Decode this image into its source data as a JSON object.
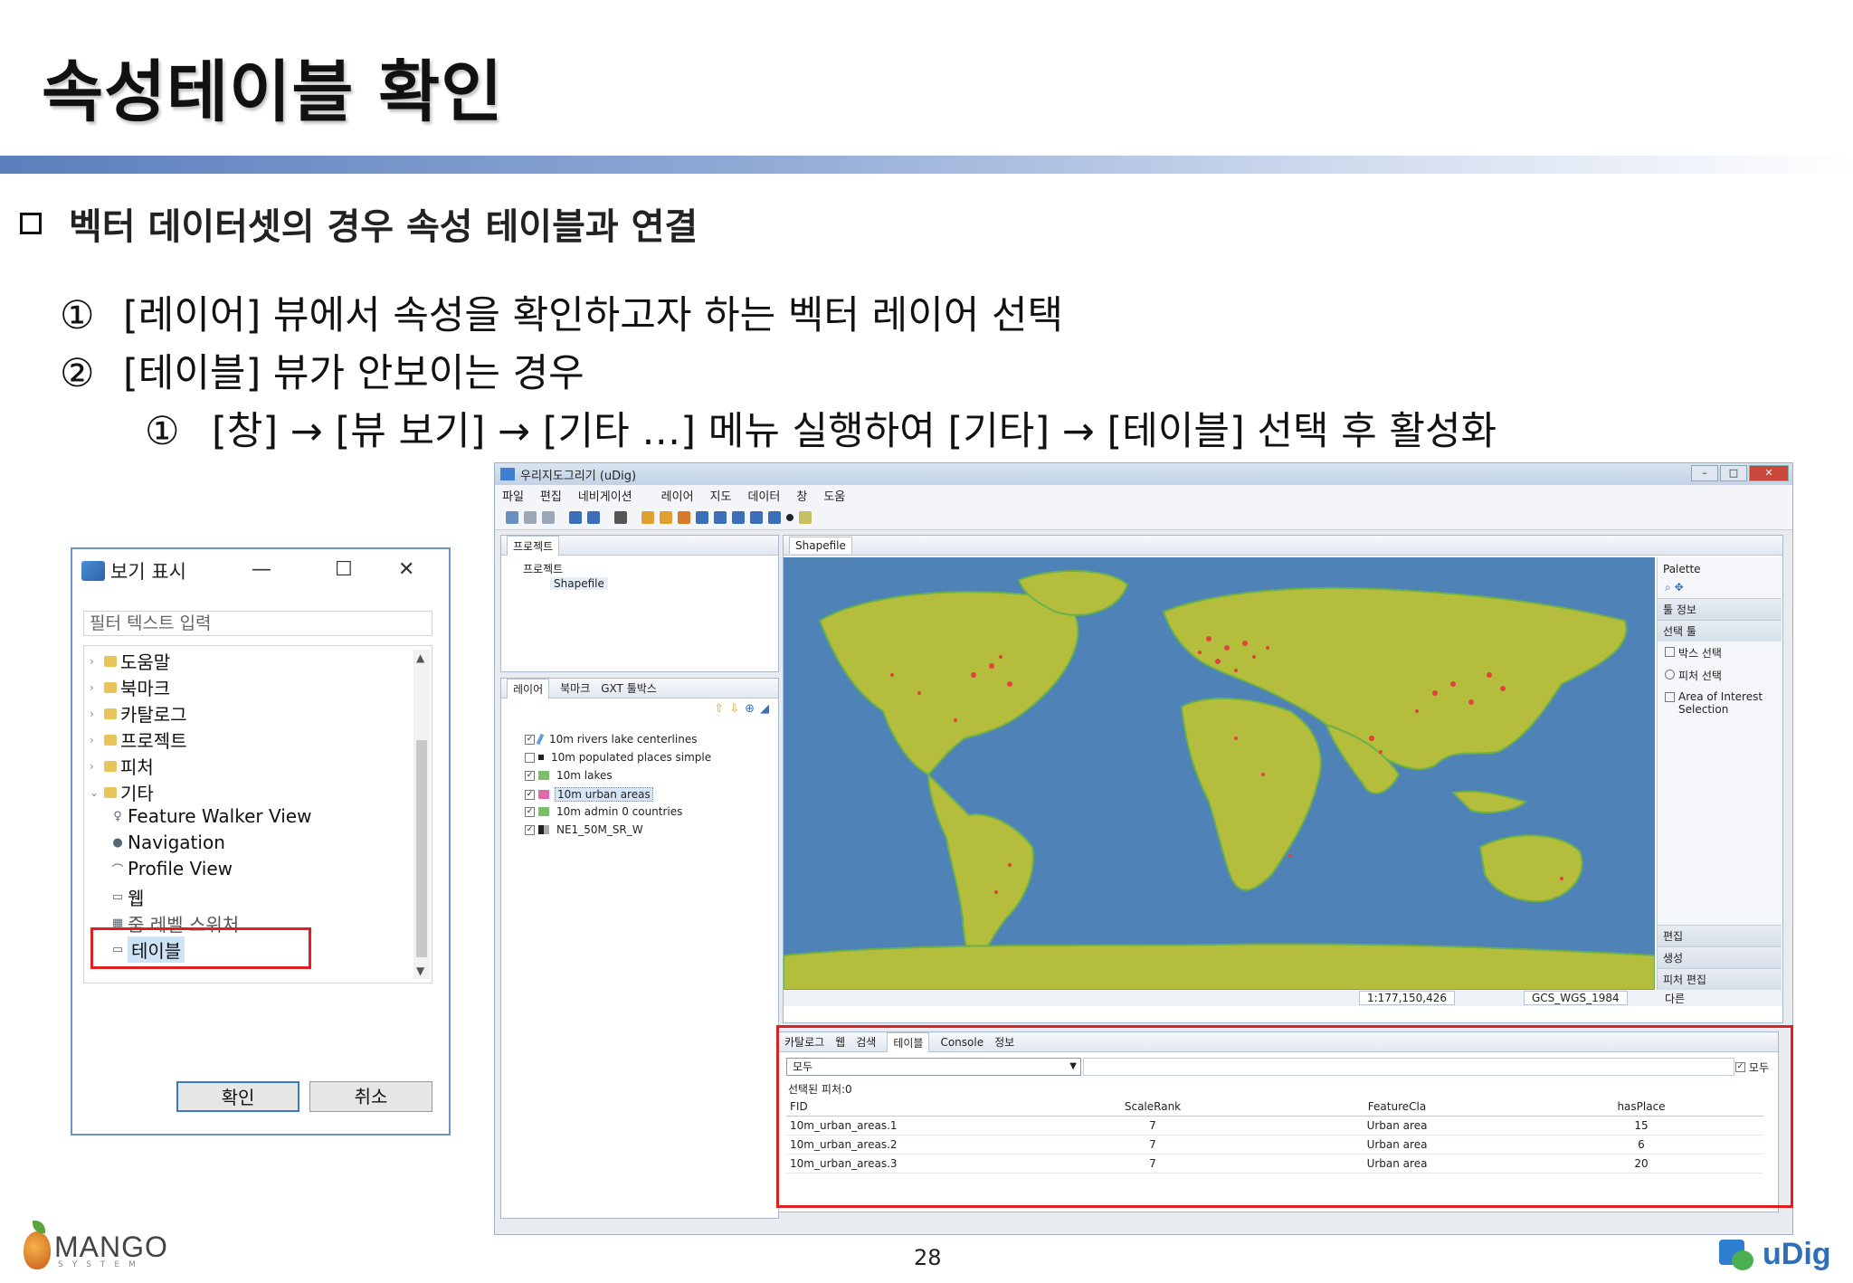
{
  "slide": {
    "title": "속성테이블 확인",
    "bullet": "벡터 데이터셋의 경우 속성 테이블과 연결",
    "steps": [
      {
        "num": "①",
        "text": "[레이어] 뷰에서 속성을 확인하고자 하는 벡터 레이어 선택"
      },
      {
        "num": "②",
        "text": "[테이블] 뷰가 안보이는 경우"
      },
      {
        "num": "①",
        "text": "[창] → [뷰 보기] → [기타 …] 메뉴 실행하여 [기타] → [테이블] 선택 후 활성화"
      }
    ],
    "page_number": "28",
    "logo_left": "MANGO",
    "logo_left_sub": "SYSTEM",
    "logo_right": "uDig"
  },
  "dialog": {
    "title": "보기 표시",
    "filter_placeholder": "필터 텍스트 입력",
    "tree": [
      {
        "label": "도움말",
        "kind": "folder"
      },
      {
        "label": "북마크",
        "kind": "folder"
      },
      {
        "label": "카탈로그",
        "kind": "folder"
      },
      {
        "label": "프로젝트",
        "kind": "folder"
      },
      {
        "label": "피처",
        "kind": "folder"
      },
      {
        "label": "기타",
        "kind": "folder-open"
      },
      {
        "label": "Feature Walker View",
        "kind": "view"
      },
      {
        "label": "Navigation",
        "kind": "view"
      },
      {
        "label": "Profile View",
        "kind": "view"
      },
      {
        "label": "웹",
        "kind": "view"
      },
      {
        "label": "줌 레벨 스위처",
        "kind": "view"
      },
      {
        "label": "테이블",
        "kind": "view-selected"
      }
    ],
    "ok": "확인",
    "cancel": "취소",
    "min": "—",
    "max": "☐",
    "close": "✕"
  },
  "udig": {
    "window_title": "우리지도그리기 (uDig)",
    "menu": [
      "파일",
      "편집",
      "네비게이션",
      "레이어",
      "지도",
      "데이터",
      "창",
      "도움"
    ],
    "project_tab": "프로젝트",
    "project_root": "프로젝트",
    "project_child": "Shapefile",
    "layer_tabs": [
      "레이어",
      "북마크",
      "GXT 툴박스"
    ],
    "layers": [
      {
        "name": "10m rivers lake centerlines",
        "checked": true,
        "color": "#6aa0d8"
      },
      {
        "name": "10m populated places simple",
        "checked": false,
        "color": "#222222"
      },
      {
        "name": "10m lakes",
        "checked": true,
        "color": "#7bbf6a"
      },
      {
        "name": "10m urban areas",
        "checked": true,
        "color": "#e06aa8",
        "selected": true
      },
      {
        "name": "10m admin 0 countries",
        "checked": true,
        "color": "#7bbf6a"
      },
      {
        "name": "NE1_50M_SR_W",
        "checked": true,
        "color": "#333333"
      }
    ],
    "map_tab": "Shapefile",
    "palette": {
      "title": "Palette",
      "sections": [
        "툴 정보",
        "선택 툴"
      ],
      "items": [
        "박스 선택",
        "피처 선택",
        "Area of Interest Selection"
      ],
      "bottom_sections": [
        "편집",
        "생성",
        "피처 편집"
      ]
    },
    "status": {
      "scale": "1:177,150,426",
      "crs": "GCS_WGS_1984",
      "extra": "다른"
    },
    "bottom_tabs": [
      "카탈로그",
      "웹",
      "검색",
      "테이블",
      "Console",
      "정보"
    ],
    "table": {
      "combo": "모두",
      "all_label": "모두",
      "selected_count": "선택된 피처:0",
      "columns": [
        "FID",
        "ScaleRank",
        "FeatureCla",
        "hasPlace"
      ],
      "rows": [
        [
          "10m_urban_areas.1",
          "7",
          "Urban area",
          "15"
        ],
        [
          "10m_urban_areas.2",
          "7",
          "Urban area",
          "6"
        ],
        [
          "10m_urban_areas.3",
          "7",
          "Urban area",
          "20"
        ]
      ]
    }
  },
  "colors": {
    "title_bar": "#5b7fbd",
    "highlight": "#e02020",
    "ocean": "#4f83b8",
    "land": "#b5bd3c",
    "urban": "#e0443c"
  }
}
